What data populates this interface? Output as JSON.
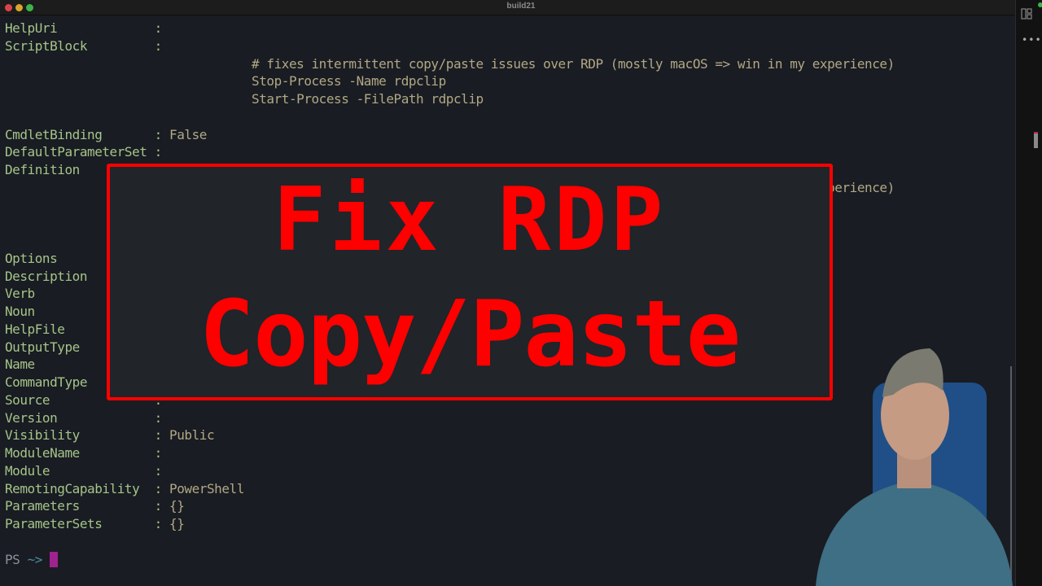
{
  "window": {
    "title": "build21",
    "traffic_lights": [
      "close",
      "minimize",
      "maximize"
    ]
  },
  "terminal": {
    "lines": [
      {
        "key": "HelpUri             ",
        "sep": ":",
        "value": ""
      },
      {
        "key": "ScriptBlock         ",
        "sep": ":",
        "value": ""
      },
      {
        "key": "",
        "sep": "",
        "value": "                                 # fixes intermittent copy/paste issues over RDP (mostly macOS => win in my experience)"
      },
      {
        "key": "",
        "sep": "",
        "value": "                                 Stop-Process -Name rdpclip"
      },
      {
        "key": "",
        "sep": "",
        "value": "                                 Start-Process -FilePath rdpclip"
      },
      {
        "key": "",
        "sep": "",
        "value": ""
      },
      {
        "key": "CmdletBinding       ",
        "sep": ":",
        "value": " False"
      },
      {
        "key": "DefaultParameterSet ",
        "sep": ":",
        "value": ""
      },
      {
        "key": "Definition          ",
        "sep": ":",
        "value": ""
      },
      {
        "key": "",
        "sep": "",
        "value": "                                 # fixes intermittent copy/paste issues over RDP (mostly macOS => win in my experience)"
      },
      {
        "key": "",
        "sep": "",
        "value": ""
      },
      {
        "key": "",
        "sep": "",
        "value": ""
      },
      {
        "key": "",
        "sep": "",
        "value": ""
      },
      {
        "key": "Options             ",
        "sep": ":",
        "value": ""
      },
      {
        "key": "Description         ",
        "sep": ":",
        "value": ""
      },
      {
        "key": "Verb                ",
        "sep": ":",
        "value": ""
      },
      {
        "key": "Noun                ",
        "sep": ":",
        "value": ""
      },
      {
        "key": "HelpFile            ",
        "sep": ":",
        "value": ""
      },
      {
        "key": "OutputType          ",
        "sep": ":",
        "value": ""
      },
      {
        "key": "Name                ",
        "sep": ":",
        "value": ""
      },
      {
        "key": "CommandType         ",
        "sep": ":",
        "value": ""
      },
      {
        "key": "Source              ",
        "sep": ":",
        "value": ""
      },
      {
        "key": "Version             ",
        "sep": ":",
        "value": ""
      },
      {
        "key": "Visibility          ",
        "sep": ":",
        "value": " Public"
      },
      {
        "key": "ModuleName          ",
        "sep": ":",
        "value": ""
      },
      {
        "key": "Module              ",
        "sep": ":",
        "value": ""
      },
      {
        "key": "RemotingCapability  ",
        "sep": ":",
        "value": " PowerShell"
      },
      {
        "key": "Parameters          ",
        "sep": ":",
        "value": " {}"
      },
      {
        "key": "ParameterSets       ",
        "sep": ":",
        "value": " {}"
      }
    ],
    "prompt": {
      "ps": "PS",
      "path": "~>"
    }
  },
  "overlay": {
    "line1": "Fix RDP",
    "line2": "Copy/Paste",
    "color": "#ff0000"
  },
  "sidebar": {
    "icons": [
      "layout-icon",
      "more-icon"
    ],
    "more_label": "•••"
  },
  "colors": {
    "key": "#a6c48a",
    "value": "#b2a886",
    "cursor": "#a0228f",
    "background": "#191c22"
  }
}
